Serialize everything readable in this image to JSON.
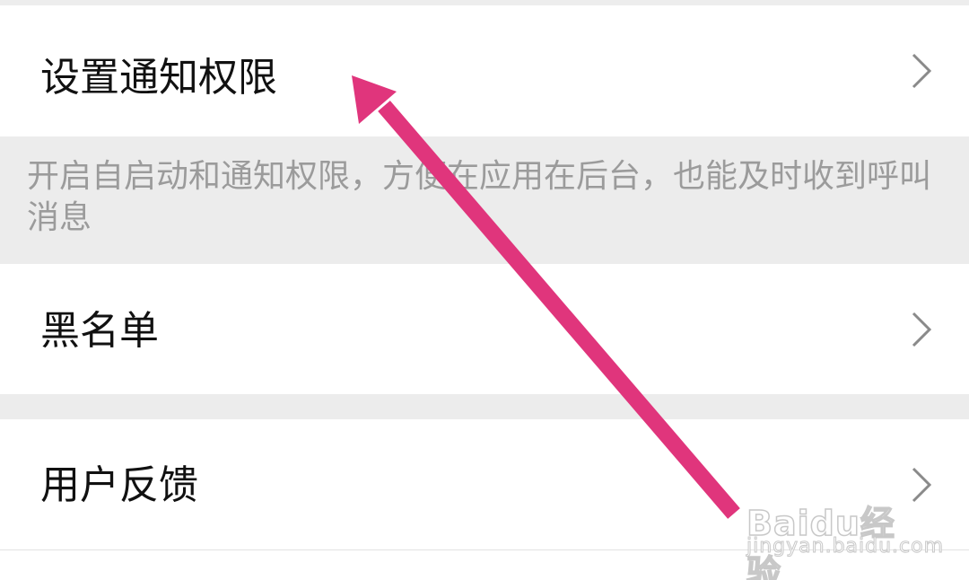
{
  "settings": {
    "items": [
      {
        "label": "设置通知权限",
        "icon": "chevron-right-icon"
      },
      {
        "label": "黑名单",
        "icon": "chevron-right-icon"
      },
      {
        "label": "用户反馈",
        "icon": "chevron-right-icon"
      }
    ],
    "notification_hint": "开启自启动和通知权限，方便在应用在后台，也能及时收到呼叫消息"
  },
  "annotation": {
    "arrow_color": "#e0357c",
    "points_to": "设置通知权限"
  },
  "watermark": {
    "brand": "Baidu经验",
    "url": "jingyan.baidu.com"
  },
  "colors": {
    "background": "#ffffff",
    "section_gray": "#ececec",
    "hint_text": "#9b9b9b",
    "label_text": "#111111",
    "chevron": "#8a8a8a"
  }
}
